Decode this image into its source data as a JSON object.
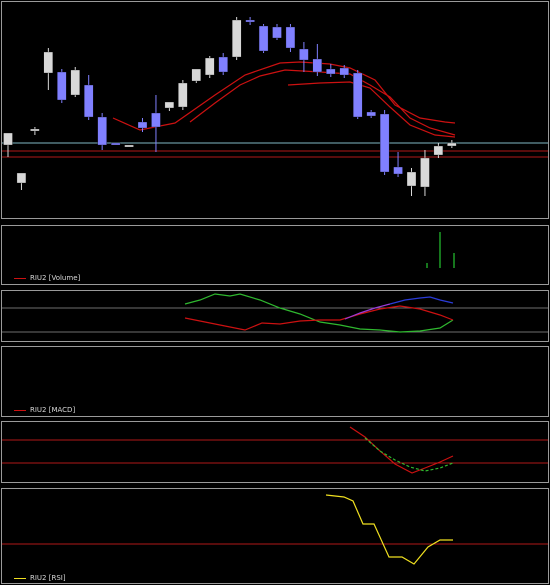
{
  "colors": {
    "background": "#000000",
    "frame": "#9a9a9a",
    "bull_candle": "#d8d8d8",
    "bear_candle": "#8080ff",
    "moving_average": "#cc1111",
    "reference_line_cyan": "#7fb7c4",
    "reference_line_red": "#b01818",
    "volume_bar": "#1fa82a",
    "rsi_line": "#f0e020",
    "macd_main": "#cc1111",
    "macd_signal": "#2fb82f"
  },
  "legends": {
    "volume": "RIU2 [Volume]",
    "macd": "RIU2 [MACD]",
    "rsi": "RIU2 [RSI]"
  },
  "chart_data": [
    {
      "type": "candlestick",
      "name": "price",
      "candles": [
        {
          "o": 145,
          "c": 133,
          "h": 142,
          "l": 157
        },
        {
          "o": 183,
          "c": 173,
          "h": 175,
          "l": 190
        },
        {
          "o": 131,
          "c": 129,
          "h": 135,
          "l": 127
        },
        {
          "o": 73,
          "c": 52,
          "h": 48,
          "l": 90
        },
        {
          "o": 72,
          "c": 100,
          "h": 69,
          "l": 103
        },
        {
          "o": 95,
          "c": 70,
          "h": 67,
          "l": 97
        },
        {
          "o": 85,
          "c": 117,
          "h": 75,
          "l": 120
        },
        {
          "o": 117,
          "c": 145,
          "h": 113,
          "l": 150
        },
        {
          "o": 143,
          "c": 145,
          "h": 143,
          "l": 145
        },
        {
          "o": 146,
          "c": 145,
          "h": 145,
          "l": 146
        },
        {
          "o": 122,
          "c": 128,
          "h": 118,
          "l": 132
        },
        {
          "o": 113,
          "c": 127,
          "h": 95,
          "l": 152
        },
        {
          "o": 108,
          "c": 102,
          "h": 103,
          "l": 111
        },
        {
          "o": 107,
          "c": 83,
          "h": 80,
          "l": 110
        },
        {
          "o": 81,
          "c": 69,
          "h": 77,
          "l": 83
        },
        {
          "o": 75,
          "c": 58,
          "h": 56,
          "l": 78
        },
        {
          "o": 57,
          "c": 72,
          "h": 53,
          "l": 75
        },
        {
          "o": 57,
          "c": 20,
          "h": 17,
          "l": 60
        },
        {
          "o": 20,
          "c": 22,
          "h": 17,
          "l": 25
        },
        {
          "o": 26,
          "c": 51,
          "h": 24,
          "l": 53
        },
        {
          "o": 27,
          "c": 38,
          "h": 24,
          "l": 40
        },
        {
          "o": 27,
          "c": 48,
          "h": 24,
          "l": 52
        },
        {
          "o": 49,
          "c": 60,
          "h": 42,
          "l": 72
        },
        {
          "o": 59,
          "c": 72,
          "h": 44,
          "l": 76
        },
        {
          "o": 69,
          "c": 74,
          "h": 64,
          "l": 77
        },
        {
          "o": 68,
          "c": 75,
          "h": 65,
          "l": 78
        },
        {
          "o": 73,
          "c": 117,
          "h": 70,
          "l": 119
        },
        {
          "o": 112,
          "c": 116,
          "h": 110,
          "l": 118
        },
        {
          "o": 114,
          "c": 172,
          "h": 110,
          "l": 175
        },
        {
          "o": 167,
          "c": 174,
          "h": 152,
          "l": 177
        },
        {
          "o": 186,
          "c": 172,
          "h": 168,
          "l": 196
        },
        {
          "o": 187,
          "c": 158,
          "h": 150,
          "l": 196
        },
        {
          "o": 155,
          "c": 146,
          "h": 143,
          "l": 158
        },
        {
          "o": 146,
          "c": 143,
          "h": 140,
          "l": 148
        }
      ],
      "moving_averages": [
        {
          "name": "ma1",
          "points": [
            [
              113,
              118
            ],
            [
              140,
              130
            ],
            [
              175,
              123
            ],
            [
              215,
              95
            ],
            [
              245,
              75
            ],
            [
              280,
              63
            ],
            [
              300,
              62
            ],
            [
              330,
              64
            ],
            [
              350,
              68
            ],
            [
              375,
              80
            ],
            [
              395,
              105
            ],
            [
              420,
              118
            ],
            [
              445,
              122
            ],
            [
              455,
              123
            ]
          ]
        },
        {
          "name": "ma2",
          "points": [
            [
              190,
              122
            ],
            [
              215,
              103
            ],
            [
              240,
              85
            ],
            [
              260,
              76
            ],
            [
              285,
              70
            ],
            [
              320,
              72
            ],
            [
              350,
              74
            ],
            [
              370,
              85
            ],
            [
              390,
              97
            ],
            [
              410,
              118
            ],
            [
              430,
              128
            ],
            [
              455,
              135
            ]
          ]
        },
        {
          "name": "ma3",
          "points": [
            [
              288,
              85
            ],
            [
              320,
              83
            ],
            [
              350,
              82
            ],
            [
              370,
              88
            ],
            [
              390,
              107
            ],
            [
              410,
              125
            ],
            [
              435,
              135
            ],
            [
              455,
              137
            ]
          ]
        }
      ],
      "reference_lines": [
        143,
        151,
        157
      ]
    },
    {
      "type": "bar",
      "name": "volume",
      "bars": [
        [
          416,
          268
        ],
        [
          427,
          263
        ],
        [
          440,
          232
        ],
        [
          454,
          253
        ]
      ],
      "legend": "RIU2 [Volume]"
    },
    {
      "type": "line",
      "name": "oscillator",
      "reference_lines": [
        308,
        332
      ],
      "series": [
        {
          "name": "green",
          "color": "#2fb82f",
          "points": [
            [
              185,
              304
            ],
            [
              200,
              300
            ],
            [
              215,
              294
            ],
            [
              230,
              296
            ],
            [
              240,
              294
            ],
            [
              260,
              300
            ],
            [
              280,
              308
            ],
            [
              300,
              314
            ],
            [
              320,
              322
            ],
            [
              340,
              325
            ],
            [
              360,
              329
            ],
            [
              380,
              330
            ],
            [
              400,
              332
            ],
            [
              420,
              331
            ],
            [
              440,
              328
            ],
            [
              453,
              320
            ]
          ]
        },
        {
          "name": "red",
          "color": "#cc1111",
          "points": [
            [
              185,
              318
            ],
            [
              205,
              322
            ],
            [
              225,
              326
            ],
            [
              245,
              330
            ],
            [
              262,
              323
            ],
            [
              280,
              324
            ],
            [
              300,
              321
            ],
            [
              320,
              320
            ],
            [
              340,
              320
            ],
            [
              360,
              314
            ],
            [
              380,
              309
            ],
            [
              400,
              306
            ],
            [
              420,
              309
            ],
            [
              440,
              315
            ],
            [
              453,
              320
            ]
          ]
        },
        {
          "name": "purple",
          "color": "#9b3bd9",
          "points": [
            [
              345,
              319
            ],
            [
              360,
              313
            ],
            [
              375,
              308
            ],
            [
              390,
              304
            ]
          ]
        },
        {
          "name": "blue",
          "color": "#2a3bd8",
          "points": [
            [
              390,
              304
            ],
            [
              405,
              300
            ],
            [
              420,
              298
            ],
            [
              430,
              297
            ],
            [
              440,
              300
            ],
            [
              453,
              303
            ]
          ]
        }
      ]
    },
    {
      "type": "line",
      "name": "macd",
      "legend": "RIU2 [MACD]",
      "series": [
        {
          "name": "main",
          "points": []
        }
      ]
    },
    {
      "type": "line",
      "name": "macd_lines",
      "reference_lines": [
        440,
        463
      ],
      "series": [
        {
          "name": "main",
          "color": "#cc1111",
          "points": [
            [
              350,
              427
            ],
            [
              365,
              437
            ],
            [
              380,
              451
            ],
            [
              395,
              464
            ],
            [
              412,
              473
            ],
            [
              425,
              468
            ],
            [
              440,
              462
            ],
            [
              453,
              456
            ]
          ]
        },
        {
          "name": "signal",
          "color": "#2fb82f",
          "dashed": true,
          "points": [
            [
              365,
              438
            ],
            [
              380,
              451
            ],
            [
              395,
              460
            ],
            [
              410,
              467
            ],
            [
              425,
              471
            ],
            [
              440,
              468
            ],
            [
              453,
              463
            ]
          ]
        }
      ]
    },
    {
      "type": "line",
      "name": "rsi",
      "legend": "RIU2 [RSI]",
      "reference_lines": [
        544
      ],
      "series": [
        {
          "name": "rsi",
          "color": "#f0e020",
          "points": [
            [
              326,
              495
            ],
            [
              344,
              497
            ],
            [
              353,
              501
            ],
            [
              363,
              524
            ],
            [
              374,
              524
            ],
            [
              389,
              557
            ],
            [
              402,
              557
            ],
            [
              414,
              564
            ],
            [
              428,
              547
            ],
            [
              440,
              540
            ],
            [
              453,
              540
            ]
          ]
        }
      ]
    }
  ]
}
